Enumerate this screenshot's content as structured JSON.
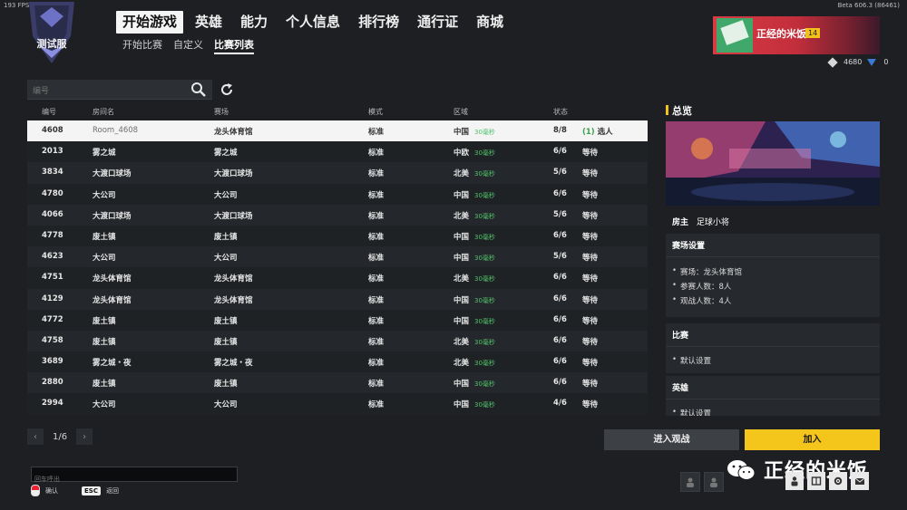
{
  "fps": "193 FPS",
  "version": "Beta 606.3 (86461)",
  "logo_text": "测试服",
  "nav": {
    "items": [
      "开始游戏",
      "英雄",
      "能力",
      "个人信息",
      "排行榜",
      "通行证",
      "商城"
    ],
    "active_index": 0
  },
  "subnav": {
    "items": [
      "开始比赛",
      "自定义",
      "比赛列表"
    ],
    "active_index": 2
  },
  "player": {
    "name": "正经的米饭",
    "level": "14",
    "coins": "4680",
    "tokens": "0"
  },
  "search": {
    "placeholder": "编号"
  },
  "table": {
    "headers": [
      "编号",
      "房间名",
      "赛场",
      "模式",
      "区域",
      "状态"
    ],
    "rows": [
      {
        "id": "4608",
        "name": "Room_4608",
        "arena": "龙头体育馆",
        "mode": "标准",
        "region": "中国",
        "ping": "30毫秒",
        "count": "8/8",
        "status": "选人",
        "queue": "(1)"
      },
      {
        "id": "2013",
        "name": "雾之城",
        "arena": "雾之城",
        "mode": "标准",
        "region": "中欧",
        "ping": "30毫秒",
        "count": "6/6",
        "status": "等待",
        "queue": ""
      },
      {
        "id": "3834",
        "name": "大渡口球场",
        "arena": "大渡口球场",
        "mode": "标准",
        "region": "北美",
        "ping": "30毫秒",
        "count": "5/6",
        "status": "等待",
        "queue": ""
      },
      {
        "id": "4780",
        "name": "大公司",
        "arena": "大公司",
        "mode": "标准",
        "region": "中国",
        "ping": "30毫秒",
        "count": "6/6",
        "status": "等待",
        "queue": ""
      },
      {
        "id": "4066",
        "name": "大渡口球场",
        "arena": "大渡口球场",
        "mode": "标准",
        "region": "北美",
        "ping": "30毫秒",
        "count": "5/6",
        "status": "等待",
        "queue": ""
      },
      {
        "id": "4778",
        "name": "废土镇",
        "arena": "废土镇",
        "mode": "标准",
        "region": "中国",
        "ping": "30毫秒",
        "count": "6/6",
        "status": "等待",
        "queue": ""
      },
      {
        "id": "4623",
        "name": "大公司",
        "arena": "大公司",
        "mode": "标准",
        "region": "中国",
        "ping": "30毫秒",
        "count": "5/6",
        "status": "等待",
        "queue": ""
      },
      {
        "id": "4751",
        "name": "龙头体育馆",
        "arena": "龙头体育馆",
        "mode": "标准",
        "region": "北美",
        "ping": "30毫秒",
        "count": "6/6",
        "status": "等待",
        "queue": ""
      },
      {
        "id": "4129",
        "name": "龙头体育馆",
        "arena": "龙头体育馆",
        "mode": "标准",
        "region": "中国",
        "ping": "30毫秒",
        "count": "6/6",
        "status": "等待",
        "queue": ""
      },
      {
        "id": "4772",
        "name": "废土镇",
        "arena": "废土镇",
        "mode": "标准",
        "region": "中国",
        "ping": "30毫秒",
        "count": "6/6",
        "status": "等待",
        "queue": ""
      },
      {
        "id": "4758",
        "name": "废土镇",
        "arena": "废土镇",
        "mode": "标准",
        "region": "北美",
        "ping": "30毫秒",
        "count": "6/6",
        "status": "等待",
        "queue": ""
      },
      {
        "id": "3689",
        "name": "雾之城・夜",
        "arena": "雾之城・夜",
        "mode": "标准",
        "region": "北美",
        "ping": "30毫秒",
        "count": "6/6",
        "status": "等待",
        "queue": ""
      },
      {
        "id": "2880",
        "name": "废土镇",
        "arena": "废土镇",
        "mode": "标准",
        "region": "中国",
        "ping": "30毫秒",
        "count": "6/6",
        "status": "等待",
        "queue": ""
      },
      {
        "id": "2994",
        "name": "大公司",
        "arena": "大公司",
        "mode": "标准",
        "region": "中国",
        "ping": "30毫秒",
        "count": "4/6",
        "status": "等待",
        "queue": ""
      }
    ]
  },
  "pagination": {
    "label": "1/6"
  },
  "overview": {
    "title": "总览",
    "host_label": "房主",
    "host_name": "足球小将",
    "arena_settings": {
      "title": "赛场设置",
      "items": [
        "赛场：龙头体育馆",
        "参赛人数：8人",
        "观战人数：4人"
      ]
    },
    "match": {
      "title": "比赛",
      "items": [
        "默认设置"
      ]
    },
    "heroes": {
      "title": "英雄",
      "items": [
        "默认设置"
      ]
    }
  },
  "buttons": {
    "spectate": "进入观战",
    "join": "加入"
  },
  "chat": {
    "placeholder": "回车呼出"
  },
  "hints": {
    "confirm": "确认",
    "esc_key": "ESC",
    "back": "返回"
  },
  "watermark": "正经的米饭",
  "colors": {
    "accent": "#f4c51b",
    "ping_green": "#52c26b",
    "background": "#1d1f22"
  }
}
